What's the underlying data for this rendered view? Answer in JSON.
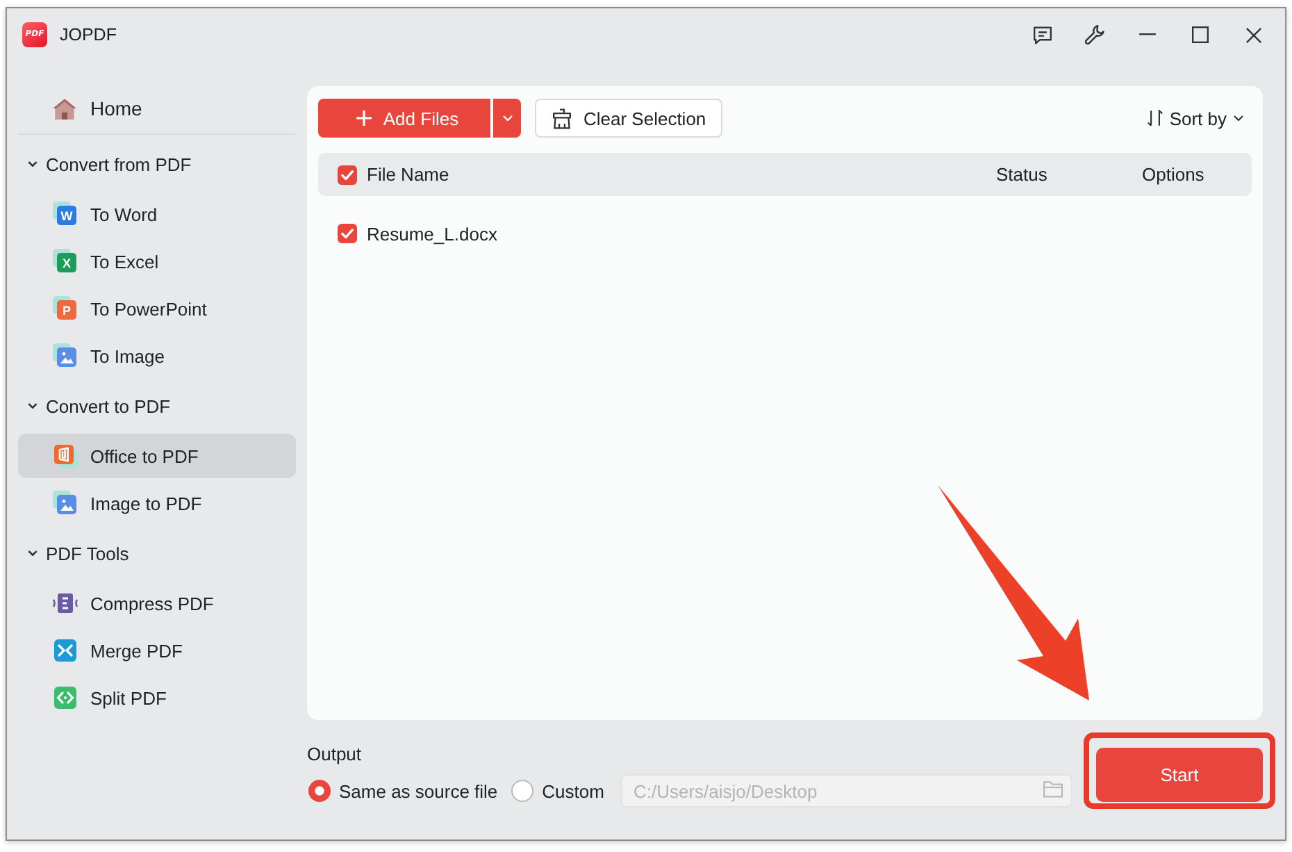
{
  "window": {
    "app_name": "JOPDF",
    "logo_text": "PDF",
    "controls": [
      {
        "kind": "feedback"
      },
      {
        "kind": "tools"
      },
      {
        "kind": "minimize"
      },
      {
        "kind": "maximize"
      },
      {
        "kind": "close"
      }
    ]
  },
  "sidebar": {
    "home": {
      "label": "Home",
      "selected": false
    },
    "sections": [
      {
        "title": "Convert from PDF",
        "expanded": true,
        "items": [
          {
            "label": "To Word",
            "kind": "word",
            "glyph": "W",
            "selected": false
          },
          {
            "label": "To Excel",
            "kind": "excel",
            "glyph": "X",
            "selected": false
          },
          {
            "label": "To PowerPoint",
            "kind": "powerpoint",
            "glyph": "P",
            "selected": false
          },
          {
            "label": "To Image",
            "kind": "image",
            "selected": false
          }
        ]
      },
      {
        "title": "Convert to PDF",
        "expanded": true,
        "items": [
          {
            "label": "Office to PDF",
            "kind": "office",
            "selected": true
          },
          {
            "label": "Image to PDF",
            "kind": "image",
            "selected": false
          }
        ]
      },
      {
        "title": "PDF Tools",
        "expanded": true,
        "items": [
          {
            "label": "Compress PDF",
            "kind": "compress",
            "selected": false
          },
          {
            "label": "Merge PDF",
            "kind": "merge",
            "selected": false
          },
          {
            "label": "Split PDF",
            "kind": "split",
            "selected": false
          }
        ]
      }
    ]
  },
  "toolbar": {
    "add_files": "Add Files",
    "clear_selection": "Clear Selection",
    "sort": "Sort by"
  },
  "table": {
    "all_checked": true,
    "columns": [
      "File Name",
      "Status",
      "Options"
    ],
    "rows": [
      {
        "file_name": "Resume_L.docx",
        "checked": true
      }
    ]
  },
  "output": {
    "label": "Output",
    "options": [
      {
        "label": "Same as source file",
        "selected": true
      },
      {
        "label": "Custom",
        "selected": false
      }
    ],
    "path": {
      "value": "C:/Users/aisjo/Desktop",
      "disabled": true
    }
  },
  "start_button": "Start",
  "annotations": {
    "arrow": true,
    "highlight_frame": true
  }
}
